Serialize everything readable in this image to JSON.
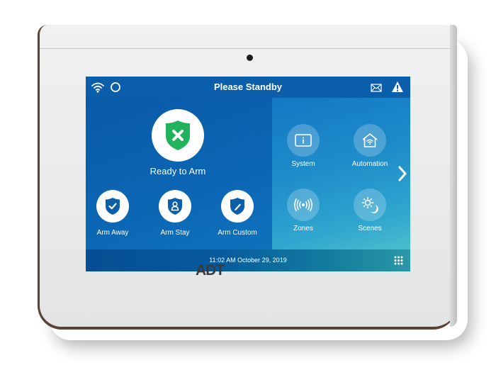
{
  "status_bar": {
    "title": "Please Standby",
    "left_icons": [
      "wifi-icon",
      "assistant-ring-icon"
    ],
    "right_icons": [
      "mail-icon",
      "warning-icon"
    ]
  },
  "arm_panel": {
    "status": {
      "label": "Ready to Arm",
      "icon": "shield-x-icon",
      "color": "#21b35b"
    },
    "actions": [
      {
        "label": "Arm Away",
        "icon": "shield-check-icon"
      },
      {
        "label": "Arm Stay",
        "icon": "shield-person-icon"
      },
      {
        "label": "Arm Custom",
        "icon": "shield-pencil-icon"
      }
    ]
  },
  "menu_panel": {
    "tiles": [
      {
        "label": "System",
        "icon": "info-screen-icon"
      },
      {
        "label": "Automation",
        "icon": "smart-home-icon"
      },
      {
        "label": "Zones",
        "icon": "wireless-signal-icon"
      },
      {
        "label": "Scenes",
        "icon": "sun-moon-icon"
      }
    ],
    "next_icon": "chevron-right-icon"
  },
  "bottom_bar": {
    "datetime": "11:02 AM October 29, 2019",
    "keypad_icon": "keypad-grid-icon"
  },
  "device": {
    "brand": "ADT"
  },
  "colors": {
    "screen_blue": "#0b5ea9",
    "ready_green": "#21b35b"
  }
}
